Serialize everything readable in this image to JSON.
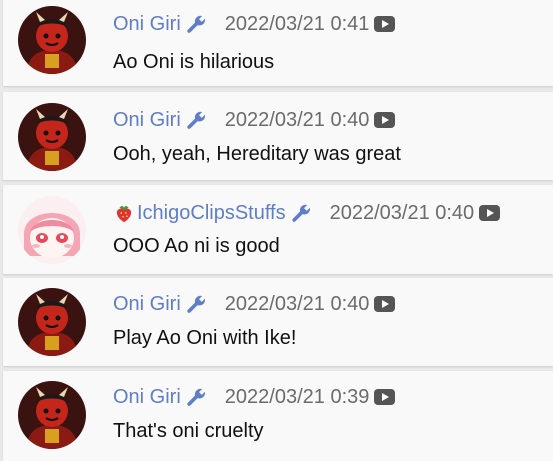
{
  "messages": [
    {
      "author": "Oni Giri",
      "timestamp": "2022/03/21 0:41",
      "text": "Ao Oni is hilarious",
      "avatar": "oni",
      "badge": "wrench-icon"
    },
    {
      "author": "Oni Giri",
      "timestamp": "2022/03/21 0:40",
      "text": "Ooh, yeah, Hereditary was great",
      "avatar": "oni",
      "badge": "wrench-icon"
    },
    {
      "author": "IchigoClipsStuffs",
      "timestamp": "2022/03/21 0:40",
      "text": "OOO Ao ni is good",
      "avatar": "ichigo",
      "badge": "wrench-icon",
      "prefix_icon": "strawberry-icon"
    },
    {
      "author": "Oni Giri",
      "timestamp": "2022/03/21 0:40",
      "text": "Play Ao Oni with Ike!",
      "avatar": "oni",
      "badge": "wrench-icon"
    },
    {
      "author": "Oni Giri",
      "timestamp": "2022/03/21 0:39",
      "text": "That's oni cruelty",
      "avatar": "oni",
      "badge": "wrench-icon"
    }
  ],
  "colors": {
    "author": "#5f7ec8",
    "timestamp": "#6b6b6b",
    "text": "#111111",
    "card": "#f9f9f9",
    "background": "#e9e9e9"
  }
}
